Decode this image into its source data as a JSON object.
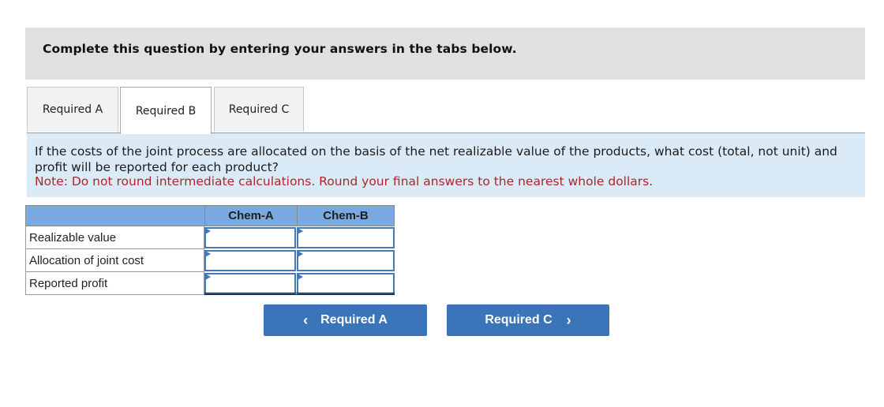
{
  "banner": {
    "instruction": "Complete this question by entering your answers in the tabs below."
  },
  "tabs": [
    {
      "label": "Required A",
      "active": false
    },
    {
      "label": "Required B",
      "active": true
    },
    {
      "label": "Required C",
      "active": false
    }
  ],
  "prompt": {
    "question": "If the costs of the joint process are allocated on the basis of the net realizable value of the products, what cost (total, not unit) and profit will be reported for each product?",
    "note": "Note: Do not round intermediate calculations. Round your final answers to the nearest whole dollars."
  },
  "table": {
    "columns": [
      "",
      "Chem-A",
      "Chem-B"
    ],
    "rows": [
      {
        "label": "Realizable value",
        "values": [
          "",
          ""
        ]
      },
      {
        "label": "Allocation of joint cost",
        "values": [
          "",
          ""
        ]
      },
      {
        "label": "Reported profit",
        "values": [
          "",
          ""
        ]
      }
    ]
  },
  "navigation": {
    "prev": {
      "label": "Required A",
      "icon": "chevron-left-icon",
      "glyph": "‹"
    },
    "next": {
      "label": "Required C",
      "icon": "chevron-right-icon",
      "glyph": "›"
    }
  },
  "colors": {
    "banner_bg": "#e0e0e0",
    "prompt_bg": "#daeaf7",
    "note_text": "#b0262a",
    "table_header_bg": "#7aa8e0",
    "button_bg": "#3b74b9"
  }
}
